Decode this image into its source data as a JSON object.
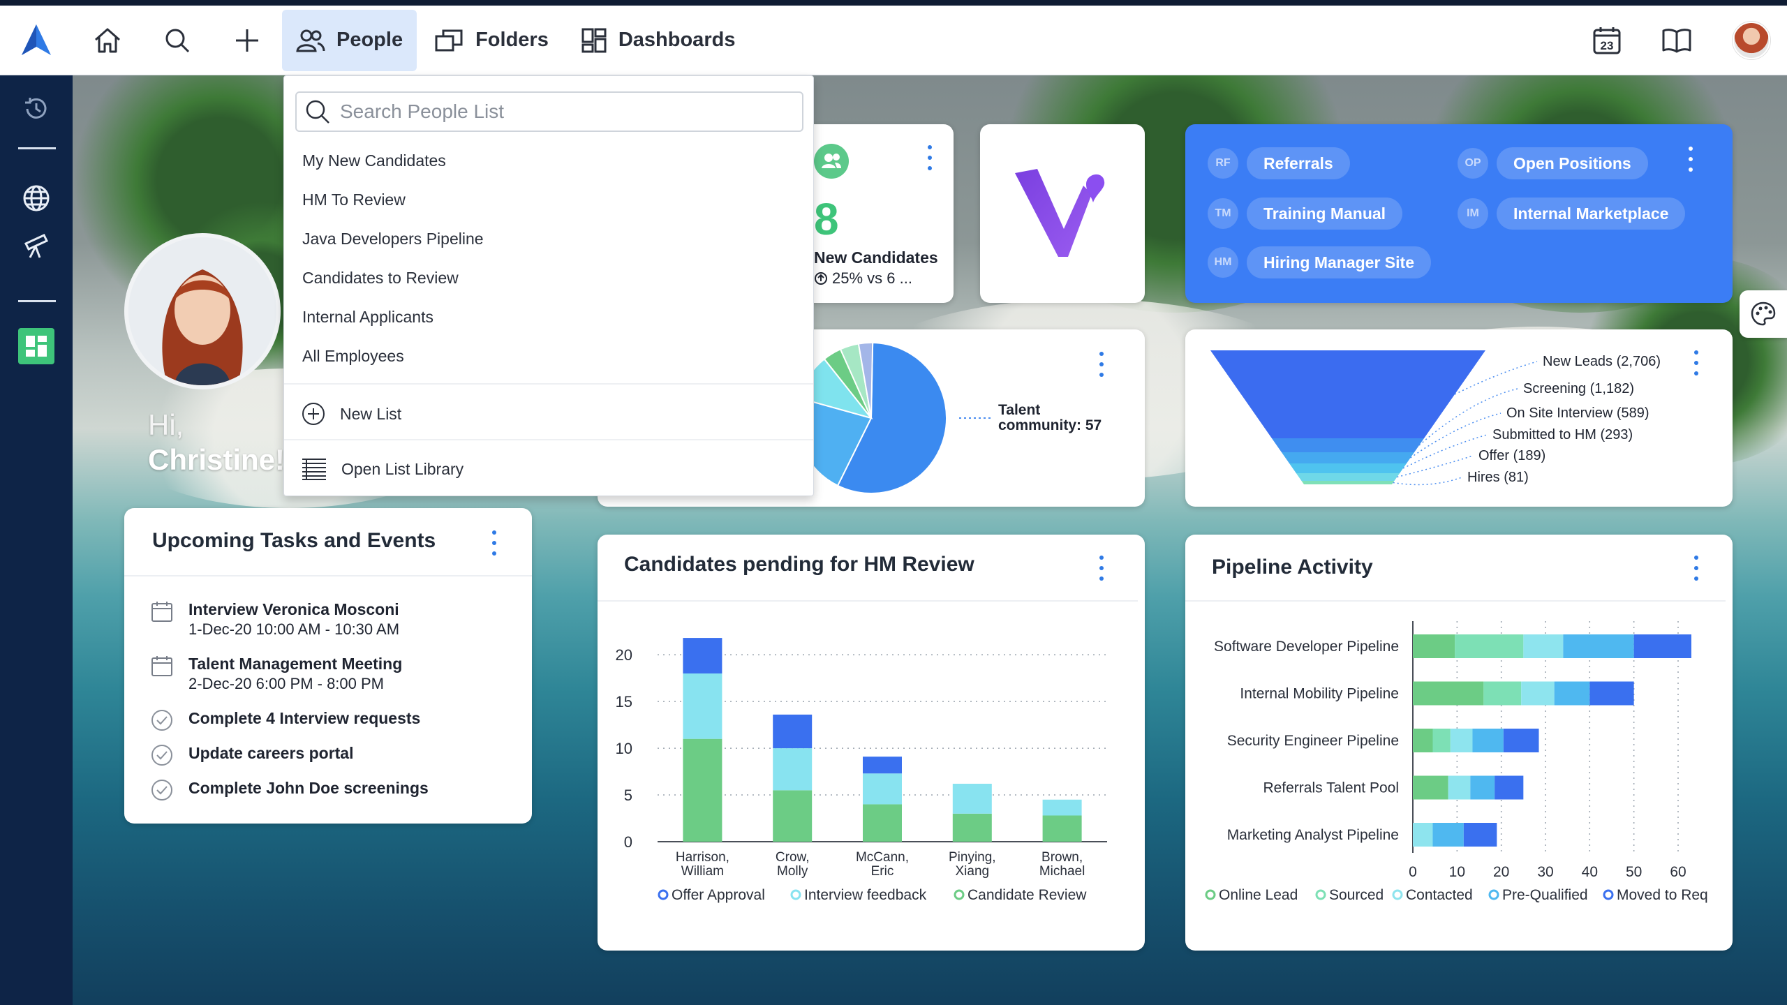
{
  "nav": {
    "people": "People",
    "folders": "Folders",
    "dashboards": "Dashboards",
    "calendar_day": "23"
  },
  "dropdown": {
    "search_placeholder": "Search People List",
    "lists": [
      "My New Candidates",
      "HM To Review",
      "Java Developers Pipeline",
      "Candidates to Review",
      "Internal Applicants",
      "All Employees"
    ],
    "new_list": "New List",
    "open_library": "Open List Library"
  },
  "greeting": {
    "hi": "Hi,",
    "name": "Christine!"
  },
  "tasks": {
    "title": "Upcoming Tasks and Events",
    "events": [
      {
        "title": "Interview Veronica Mosconi",
        "time": "1-Dec-20 10:00 AM - 10:30 AM"
      },
      {
        "title": "Talent Management Meeting",
        "time": "2-Dec-20 6:00 PM - 8:00 PM"
      }
    ],
    "todos": [
      "Complete 4 Interview requests",
      "Update careers portal",
      "Complete John Doe screenings"
    ]
  },
  "new_candidates": {
    "count": "8",
    "label": "New Candidates",
    "trend": "25% vs 6 ..."
  },
  "quick_links": [
    {
      "abbr": "RF",
      "label": "Referrals"
    },
    {
      "abbr": "OP",
      "label": "Open Positions"
    },
    {
      "abbr": "TM",
      "label": "Training Manual"
    },
    {
      "abbr": "IM",
      "label": "Internal Marketplace"
    },
    {
      "abbr": "HM",
      "label": "Hiring Manager Site"
    }
  ],
  "pie": {
    "label_line1": "Talent",
    "label_line2": "community: 57"
  },
  "funnel": {
    "stages": [
      "New Leads (2,706)",
      "Screening (1,182)",
      "On Site Interview (589)",
      "Submitted to HM (293)",
      "Offer (189)",
      "Hires (81)"
    ],
    "values": [
      2706,
      1182,
      589,
      293,
      189,
      81
    ],
    "colors": [
      "#3b6cf0",
      "#3f8ef0",
      "#45a9f0",
      "#4fc3ef",
      "#6fd8e8",
      "#7fe0b8"
    ]
  },
  "hm_review": {
    "title": "Candidates pending for HM Review"
  },
  "pipeline": {
    "title": "Pipeline Activity"
  },
  "colors": {
    "accent": "#2f7ae5",
    "nav_bg": "#0e2447",
    "quick_links_bg": "#3b7df5"
  },
  "chart_data": [
    {
      "type": "bar",
      "stacked": true,
      "categories": [
        "Harrison, William",
        "Crow, Molly",
        "McCann, Eric",
        "Pinying, Xiang",
        "Brown, Michael"
      ],
      "series": [
        {
          "name": "Candidate Review",
          "color": "#6ccc85",
          "values": [
            11,
            5.5,
            4,
            3,
            2.8
          ]
        },
        {
          "name": "Interview feedback",
          "color": "#88e3f0",
          "values": [
            7,
            4.5,
            3.3,
            3.2,
            1.7
          ]
        },
        {
          "name": "Offer Approval",
          "color": "#3a70ef",
          "values": [
            3.8,
            3.6,
            1.8,
            0,
            0
          ]
        }
      ],
      "legend": [
        "Offer Approval",
        "Interview feedback",
        "Candidate Review"
      ],
      "yticks": [
        0,
        5,
        10,
        15,
        20
      ],
      "ylim": [
        0,
        23
      ],
      "grid": true
    },
    {
      "type": "bar",
      "orientation": "horizontal",
      "stacked": true,
      "categories": [
        "Software Developer Pipeline",
        "Internal Mobility Pipeline",
        "Security Engineer Pipeline",
        "Referrals Talent Pool",
        "Marketing Analyst Pipeline"
      ],
      "series": [
        {
          "name": "Online Lead",
          "color": "#6ccc85",
          "values": [
            9.5,
            16,
            4.5,
            8,
            0
          ]
        },
        {
          "name": "Sourced",
          "color": "#7de0b5",
          "values": [
            15.5,
            8.5,
            4,
            0,
            0
          ]
        },
        {
          "name": "Contacted",
          "color": "#8ee4ee",
          "values": [
            9,
            7.5,
            5,
            5,
            4.5
          ]
        },
        {
          "name": "Pre-Qualified",
          "color": "#4fb8f0",
          "values": [
            16,
            8,
            7,
            5.5,
            7
          ]
        },
        {
          "name": "Moved to Req",
          "color": "#3a70ef",
          "values": [
            13,
            10,
            8,
            6.5,
            7.5
          ]
        }
      ],
      "xticks": [
        0,
        10,
        20,
        30,
        40,
        50,
        60
      ],
      "xlim": [
        0,
        60
      ],
      "grid": true
    },
    {
      "type": "pie",
      "values": [
        57,
        22,
        10,
        4,
        4,
        3
      ],
      "colors": [
        "#3b8af0",
        "#4fb0f2",
        "#7fe3ee",
        "#6ccc85",
        "#a6e7c4",
        "#a3b6e8"
      ],
      "annotation": "Talent community: 57"
    }
  ]
}
